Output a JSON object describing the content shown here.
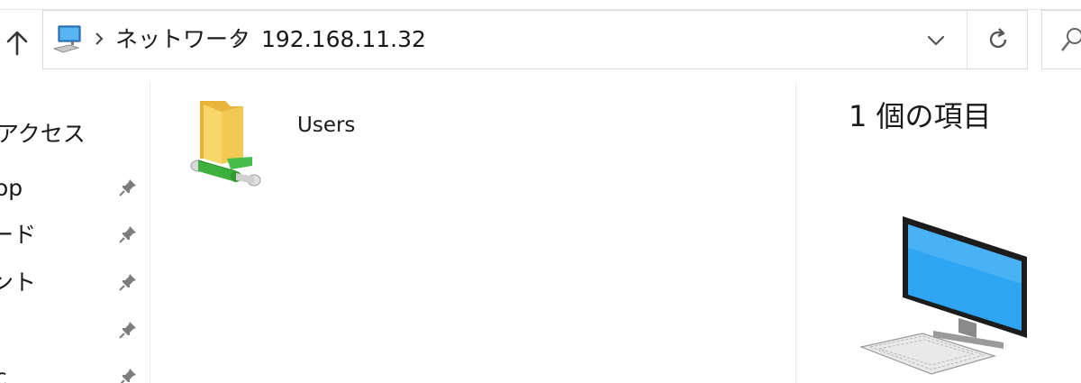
{
  "address_bar": {
    "breadcrumbs": [
      {
        "label": "ネットワーク"
      },
      {
        "label": "192.168.11.32"
      }
    ]
  },
  "nav_pane": {
    "items": [
      {
        "label": "アクセス",
        "pinned": false
      },
      {
        "label": "op",
        "pinned": true
      },
      {
        "label": "ード",
        "pinned": true
      },
      {
        "label": "ント",
        "pinned": true
      },
      {
        "label": "",
        "pinned": true
      },
      {
        "label": "c",
        "pinned": true
      }
    ]
  },
  "content": {
    "items": [
      {
        "name": "Users",
        "icon": "network-share-folder-icon"
      }
    ]
  },
  "details_pane": {
    "item_count": "1 個の項目"
  },
  "colors": {
    "folder_yellow": "#f5c542",
    "network_green": "#3db03d",
    "monitor_blue": "#2aa0f0"
  }
}
